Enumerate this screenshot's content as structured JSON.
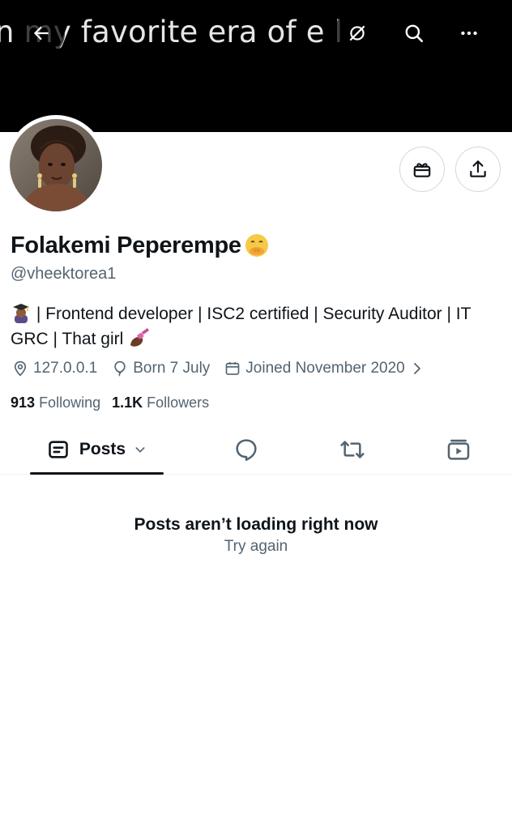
{
  "banner": {
    "text": "n my favorite era of e l",
    "background": "#000000"
  },
  "top_bar": {
    "back_icon": "arrow-left-icon",
    "bookmark_icon": "no-notifications-icon",
    "search_icon": "search-icon",
    "more_icon": "more-icon"
  },
  "profile": {
    "display_name": "Folakemi Peperempe",
    "name_emoji": "face-with-hand-over-mouth",
    "handle": "@vheektorea1",
    "bio_part1": "| Frontend developer | ISC2 certified | Security Auditor | IT GRC | That girl",
    "bio_lead_emoji": "student-emoji",
    "bio_trail_emoji": "nail-polish-emoji",
    "location": "127.0.0.1",
    "birthday": "Born 7 July",
    "joined": "Joined November 2020",
    "following_count": "913",
    "following_label": "Following",
    "followers_count": "1.1K",
    "followers_label": "Followers"
  },
  "actions": {
    "gift_icon": "gift-icon",
    "share_icon": "share-icon"
  },
  "tabs": {
    "posts_label": "Posts",
    "replies_icon": "reply-bubble-icon",
    "reposts_icon": "repost-icon",
    "media_icon": "video-icon"
  },
  "empty_state": {
    "title": "Posts aren’t loading right now",
    "retry": "Try again"
  },
  "colors": {
    "text_primary": "#0f1419",
    "text_secondary": "#536471",
    "border": "#cfd9de"
  }
}
